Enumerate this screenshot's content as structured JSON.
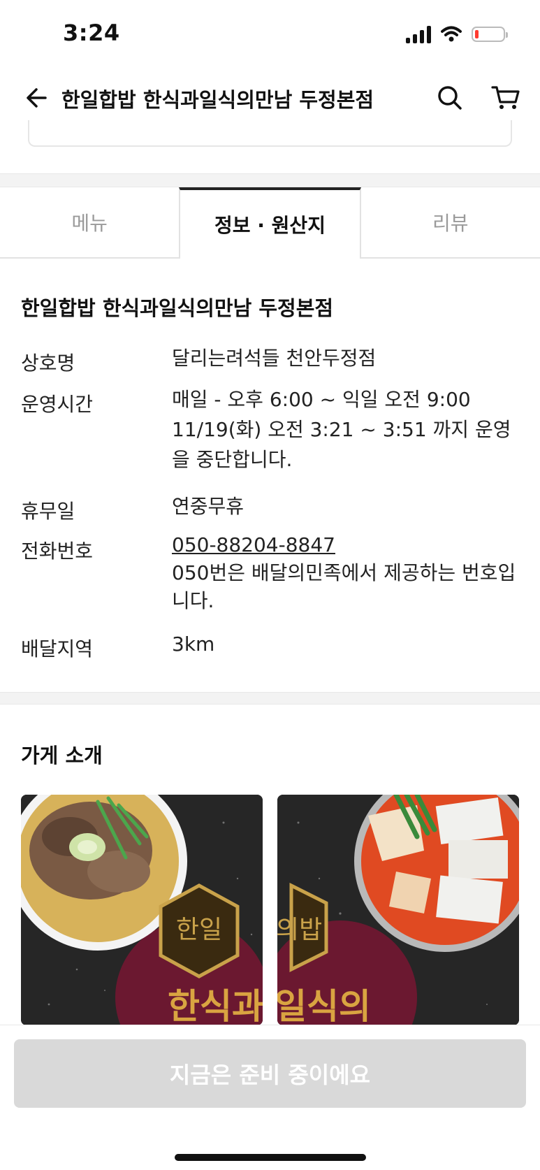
{
  "status_bar": {
    "time": "3:24"
  },
  "header": {
    "title": "한일합밥 한식과일식의만남 두정본점"
  },
  "tabs": [
    {
      "label": "메뉴",
      "active": false
    },
    {
      "label": "정보 · 원산지",
      "active": true
    },
    {
      "label": "리뷰",
      "active": false
    }
  ],
  "info": {
    "store_name": "한일합밥 한식과일식의만남 두정본점",
    "rows": [
      {
        "label": "상호명",
        "value": "달리는려석들 천안두정점"
      },
      {
        "label": "운영시간",
        "value": "매일 - 오후 6:00 ~ 익일 오전 9:00",
        "note": "11/19(화) 오전 3:21 ~ 3:51 까지 운영을 중단합니다."
      },
      {
        "label": "휴무일",
        "value": "연중무휴"
      },
      {
        "label": "전화번호",
        "value": "050-88204-8847",
        "note": "050번은 배달의민족에서 제공하는 번호입니다."
      },
      {
        "label": "배달지역",
        "value": "3km"
      }
    ]
  },
  "intro": {
    "title": "가게 소개",
    "images": [
      {
        "name": "intro-image-left",
        "overlay_text": "한식과"
      },
      {
        "name": "intro-image-right",
        "overlay_text": "일식의"
      }
    ]
  },
  "bottom": {
    "cta_label": "지금은 준비 중이에요"
  },
  "colors": {
    "active_tab_border": "#222222",
    "disabled_button": "#d9d9d9",
    "label_gray": "#9a9a9a"
  }
}
